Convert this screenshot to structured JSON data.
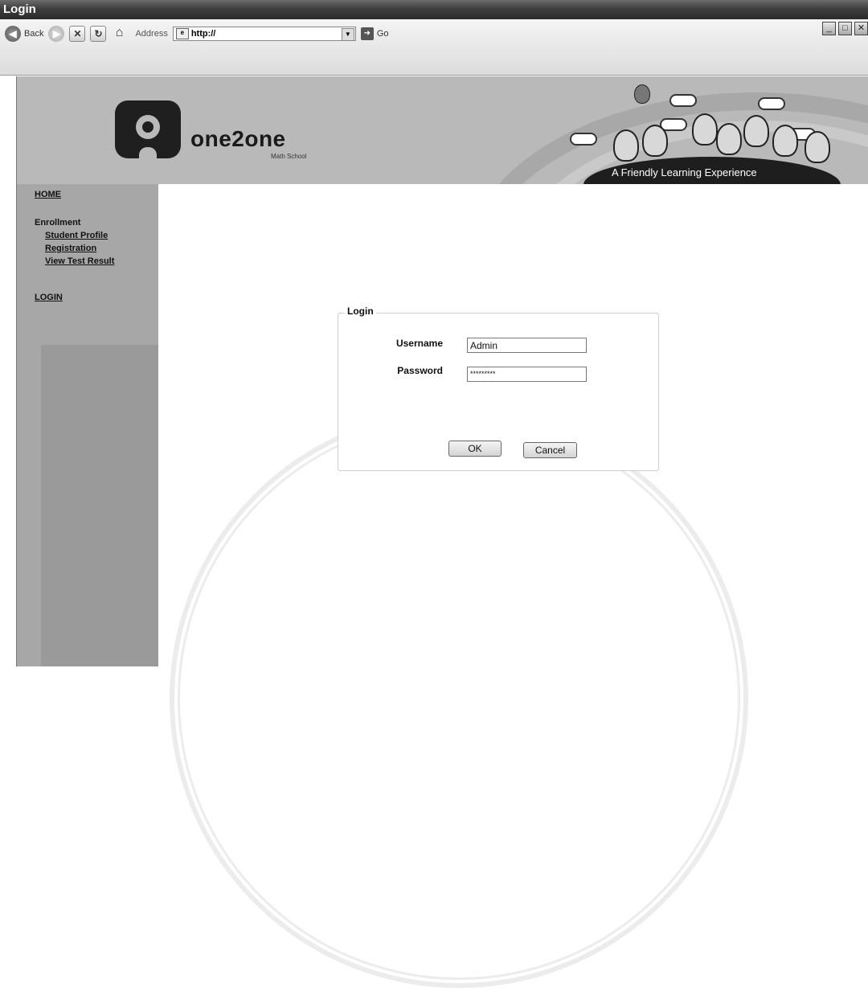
{
  "window": {
    "title": "Login"
  },
  "browser": {
    "back_label": "Back",
    "address_label": "Address",
    "address_value": "http://",
    "go_label": "Go"
  },
  "header": {
    "brand": "one2one",
    "brand_sub": "Math School",
    "tagline": "A Friendly Learning Experience"
  },
  "sidebar": {
    "home": "HOME",
    "enrollment_heading": "Enrollment",
    "items": [
      "Student Profile",
      "Registration",
      "View Test Result"
    ],
    "login": "LOGIN"
  },
  "login_form": {
    "legend": "Login",
    "username_label": "Username",
    "username_value": "Admin",
    "password_label": "Password",
    "password_value": "*********",
    "ok_label": "OK",
    "cancel_label": "Cancel"
  }
}
